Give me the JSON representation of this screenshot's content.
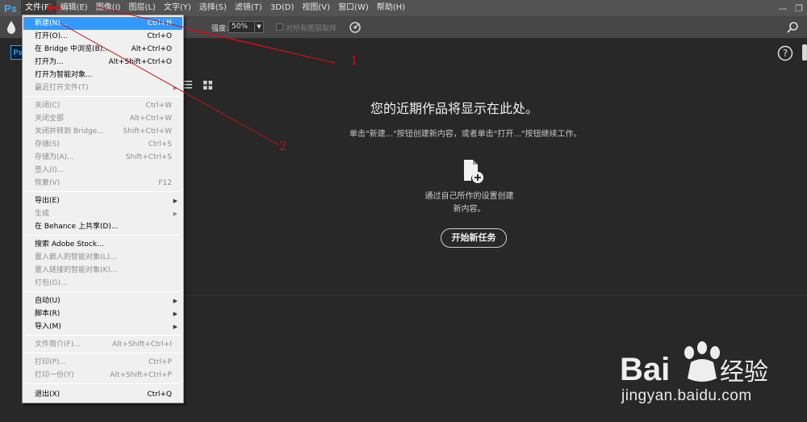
{
  "app": {
    "logo_text": "Ps"
  },
  "menubar": {
    "items": [
      "文件(F)",
      "编辑(E)",
      "图像(I)",
      "图层(L)",
      "文字(Y)",
      "选择(S)",
      "滤镜(T)",
      "3D(D)",
      "视图(V)",
      "窗口(W)",
      "帮助(H)"
    ],
    "window_controls": {
      "minimize": "—",
      "restore": "❐"
    }
  },
  "options_bar": {
    "strength_label": "强度:",
    "strength_value": "50%",
    "sample_all_layers_label": "对所有图层取样"
  },
  "home": {
    "badge": "Ps",
    "help_glyph": "?",
    "heading": "您的近期作品将显示在此处。",
    "subtext": "单击\"新建...\"按钮创建新内容，或者单击\"打开...\"按钮继续工作。",
    "new_desc_line1": "通过自己所作的设置创建",
    "new_desc_line2": "新内容。",
    "start_button": "开始新任务"
  },
  "file_menu": {
    "items": [
      {
        "label": "新建(N)...",
        "shortcut": "Ctrl+N"
      },
      {
        "label": "打开(O)...",
        "shortcut": "Ctrl+O"
      },
      {
        "label": "在 Bridge 中浏览(B)...",
        "shortcut": "Alt+Ctrl+O"
      },
      {
        "label": "打开为...",
        "shortcut": "Alt+Shift+Ctrl+O"
      },
      {
        "label": "打开为智能对象...",
        "shortcut": ""
      },
      {
        "label": "最近打开文件(T)",
        "shortcut": ""
      },
      {
        "label": "关闭(C)",
        "shortcut": "Ctrl+W"
      },
      {
        "label": "关闭全部",
        "shortcut": "Alt+Ctrl+W"
      },
      {
        "label": "关闭并转到 Bridge...",
        "shortcut": "Shift+Ctrl+W"
      },
      {
        "label": "存储(S)",
        "shortcut": "Ctrl+S"
      },
      {
        "label": "存储为(A)...",
        "shortcut": "Shift+Ctrl+S"
      },
      {
        "label": "签入(I)...",
        "shortcut": ""
      },
      {
        "label": "恢复(V)",
        "shortcut": "F12"
      },
      {
        "label": "导出(E)",
        "shortcut": ""
      },
      {
        "label": "生成",
        "shortcut": ""
      },
      {
        "label": "在 Behance 上共享(D)...",
        "shortcut": ""
      },
      {
        "label": "搜索 Adobe Stock...",
        "shortcut": ""
      },
      {
        "label": "置入嵌入的智能对象(L)...",
        "shortcut": ""
      },
      {
        "label": "置入链接的智能对象(K)...",
        "shortcut": ""
      },
      {
        "label": "打包(G)...",
        "shortcut": ""
      },
      {
        "label": "自动(U)",
        "shortcut": ""
      },
      {
        "label": "脚本(R)",
        "shortcut": ""
      },
      {
        "label": "导入(M)",
        "shortcut": ""
      },
      {
        "label": "文件简介(F)...",
        "shortcut": "Alt+Shift+Ctrl+I"
      },
      {
        "label": "打印(P)...",
        "shortcut": "Ctrl+P"
      },
      {
        "label": "打印一份(Y)",
        "shortcut": "Alt+Shift+Ctrl+P"
      },
      {
        "label": "退出(X)",
        "shortcut": "Ctrl+Q"
      }
    ],
    "submenu_arrow": "▶"
  },
  "annotations": {
    "label_1": "1",
    "label_2": "2",
    "color": "#c0141c"
  },
  "watermark": {
    "url": "jingyan.baidu.com",
    "brand_text": "Bai",
    "brand_suffix": "经验"
  },
  "colors": {
    "accent": "#3399ff",
    "menubar": "#535353",
    "workspace": "#282828"
  }
}
